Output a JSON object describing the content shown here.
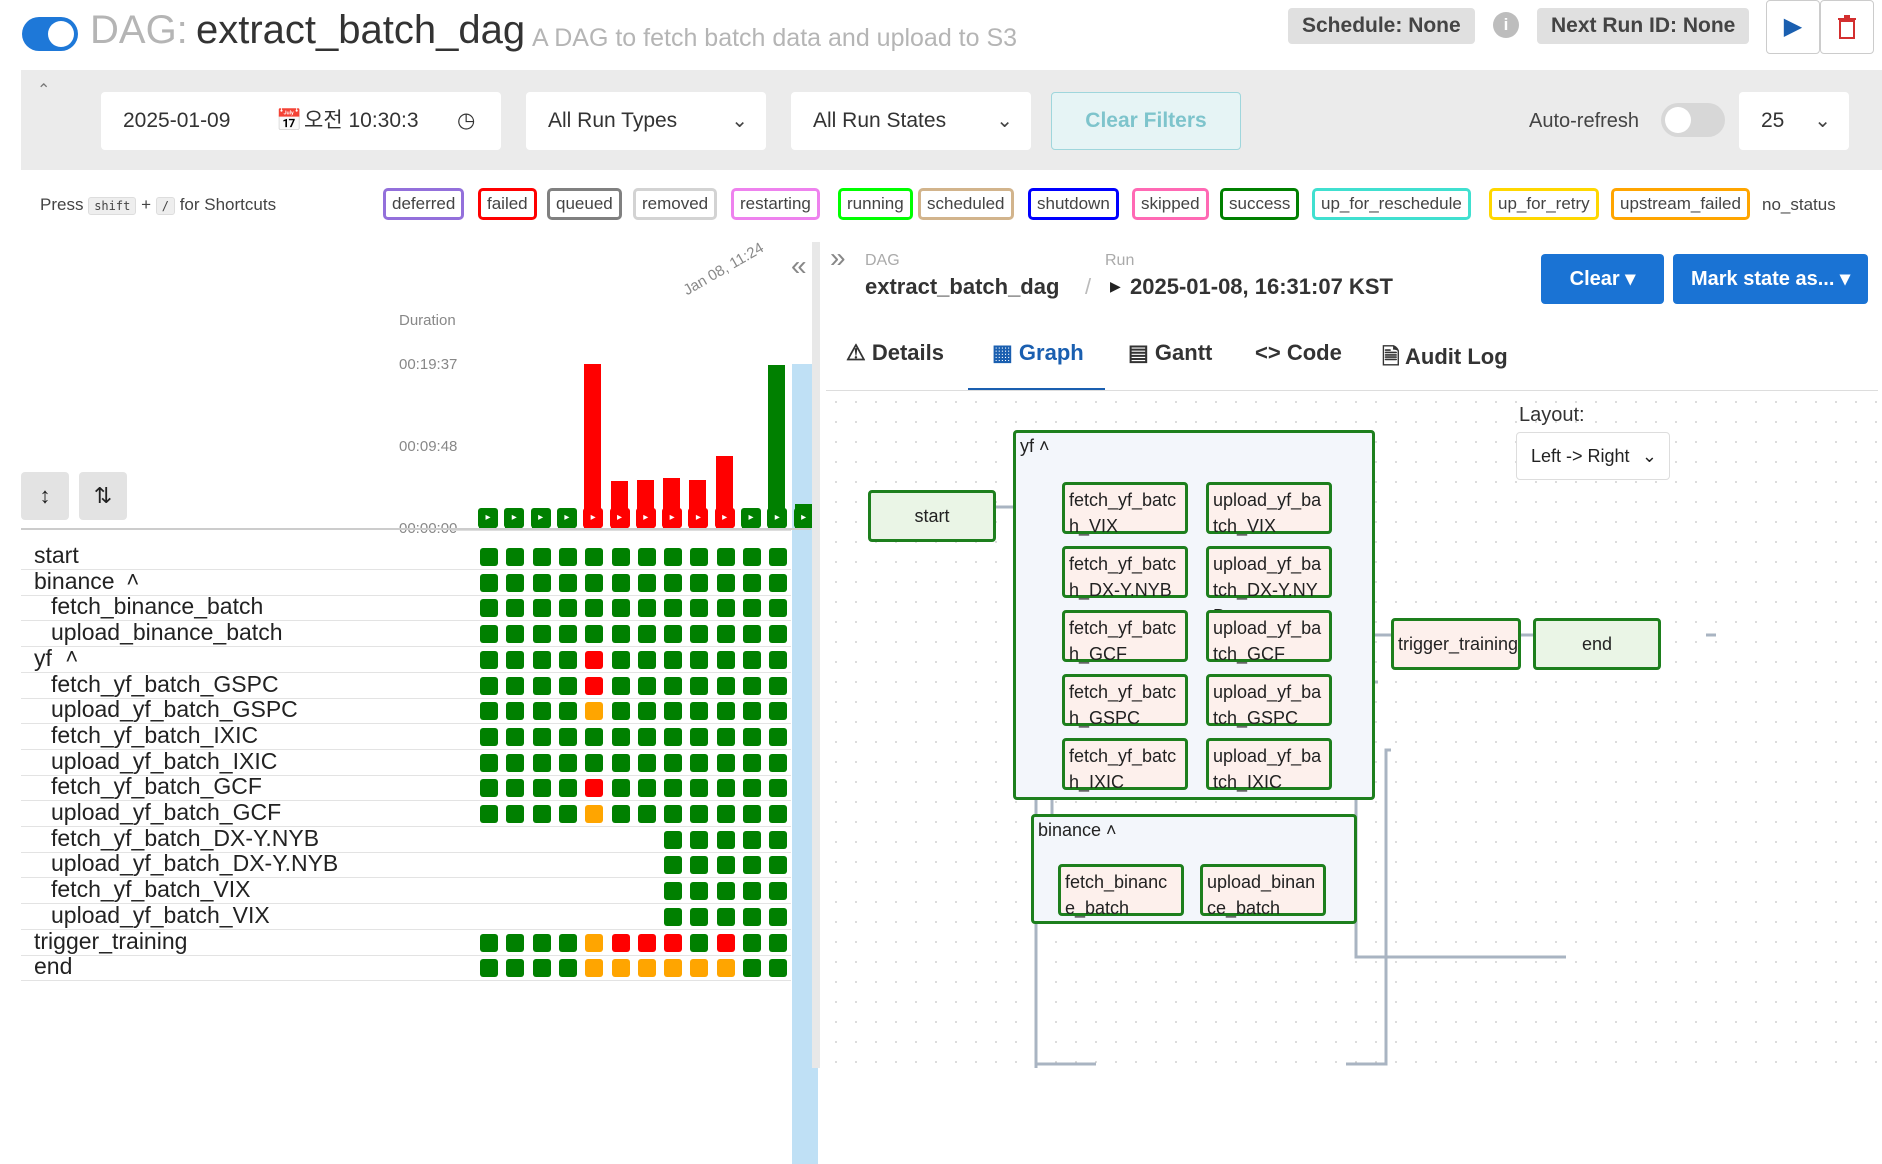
{
  "header": {
    "dag_prefix": "DAG:",
    "dag_name": "extract_batch_dag",
    "description": "A DAG to fetch batch data and upload to S3",
    "schedule": "Schedule: None",
    "next_run": "Next Run ID: None"
  },
  "filters": {
    "date": "2025-01-09",
    "time": "오전 10:30:3",
    "run_types": "All Run Types",
    "run_states": "All Run States",
    "clear_filters": "Clear Filters",
    "auto_refresh": "Auto-refresh",
    "page_size": "25"
  },
  "legend": {
    "press": "Press",
    "key1": "shift",
    "plus": "+",
    "key2": "/",
    "for_shortcuts": "for Shortcuts",
    "states": [
      {
        "label": "deferred",
        "color": "#9370DB"
      },
      {
        "label": "failed",
        "color": "#FF0000"
      },
      {
        "label": "queued",
        "color": "#808080"
      },
      {
        "label": "removed",
        "color": "#D3D3D3"
      },
      {
        "label": "restarting",
        "color": "#EE82EE"
      },
      {
        "label": "running",
        "color": "#00FF00"
      },
      {
        "label": "scheduled",
        "color": "#D2B48C"
      },
      {
        "label": "shutdown",
        "color": "#0000FF"
      },
      {
        "label": "skipped",
        "color": "#FF69B4"
      },
      {
        "label": "success",
        "color": "#008000"
      },
      {
        "label": "up_for_reschedule",
        "color": "#40E0D0"
      },
      {
        "label": "up_for_retry",
        "color": "#FFD700"
      },
      {
        "label": "upstream_failed",
        "color": "#FFA500"
      }
    ],
    "no_status": "no_status"
  },
  "grid": {
    "duration_label": "Duration",
    "ticks": [
      "00:19:37",
      "00:09:48",
      "00:00:00"
    ],
    "date_label": "Jan 08, 11:24",
    "run_durations_min": [
      0.6,
      0.6,
      0.6,
      0.6,
      19.6,
      5.6,
      5.8,
      6.0,
      5.8,
      8.6,
      0.6,
      19.5,
      2.9
    ],
    "run_states": [
      "success",
      "success",
      "success",
      "success",
      "failed",
      "failed",
      "failed",
      "failed",
      "failed",
      "failed",
      "success",
      "success",
      "success"
    ],
    "rows": [
      {
        "label": "start",
        "indent": 0,
        "cells": [
          "g",
          "g",
          "g",
          "g",
          "g",
          "g",
          "g",
          "g",
          "g",
          "g",
          "g",
          "g"
        ]
      },
      {
        "label": "binance",
        "indent": 0,
        "group": true,
        "cells": [
          "g",
          "g",
          "g",
          "g",
          "g",
          "g",
          "g",
          "g",
          "g",
          "g",
          "g",
          "g"
        ]
      },
      {
        "label": "fetch_binance_batch",
        "indent": 1,
        "cells": [
          "g",
          "g",
          "g",
          "g",
          "g",
          "g",
          "g",
          "g",
          "g",
          "g",
          "g",
          "g"
        ]
      },
      {
        "label": "upload_binance_batch",
        "indent": 1,
        "cells": [
          "g",
          "g",
          "g",
          "g",
          "g",
          "g",
          "g",
          "g",
          "g",
          "g",
          "g",
          "g"
        ]
      },
      {
        "label": "yf",
        "indent": 0,
        "group": true,
        "cells": [
          "g",
          "g",
          "g",
          "g",
          "r",
          "g",
          "g",
          "g",
          "g",
          "g",
          "g",
          "g"
        ]
      },
      {
        "label": "fetch_yf_batch_GSPC",
        "indent": 1,
        "cells": [
          "g",
          "g",
          "g",
          "g",
          "r",
          "g",
          "g",
          "g",
          "g",
          "g",
          "g",
          "g"
        ]
      },
      {
        "label": "upload_yf_batch_GSPC",
        "indent": 1,
        "cells": [
          "g",
          "g",
          "g",
          "g",
          "o",
          "g",
          "g",
          "g",
          "g",
          "g",
          "g",
          "g"
        ]
      },
      {
        "label": "fetch_yf_batch_IXIC",
        "indent": 1,
        "cells": [
          "g",
          "g",
          "g",
          "g",
          "g",
          "g",
          "g",
          "g",
          "g",
          "g",
          "g",
          "g"
        ]
      },
      {
        "label": "upload_yf_batch_IXIC",
        "indent": 1,
        "cells": [
          "g",
          "g",
          "g",
          "g",
          "g",
          "g",
          "g",
          "g",
          "g",
          "g",
          "g",
          "g"
        ]
      },
      {
        "label": "fetch_yf_batch_GCF",
        "indent": 1,
        "cells": [
          "g",
          "g",
          "g",
          "g",
          "r",
          "g",
          "g",
          "g",
          "g",
          "g",
          "g",
          "g"
        ]
      },
      {
        "label": "upload_yf_batch_GCF",
        "indent": 1,
        "cells": [
          "g",
          "g",
          "g",
          "g",
          "o",
          "g",
          "g",
          "g",
          "g",
          "g",
          "g",
          "g"
        ]
      },
      {
        "label": "fetch_yf_batch_DX-Y.NYB",
        "indent": 1,
        "cells": [
          "",
          "",
          "",
          "",
          "",
          "",
          "",
          "g",
          "g",
          "g",
          "g",
          "g"
        ]
      },
      {
        "label": "upload_yf_batch_DX-Y.NYB",
        "indent": 1,
        "cells": [
          "",
          "",
          "",
          "",
          "",
          "",
          "",
          "g",
          "g",
          "g",
          "g",
          "g"
        ]
      },
      {
        "label": "fetch_yf_batch_VIX",
        "indent": 1,
        "cells": [
          "",
          "",
          "",
          "",
          "",
          "",
          "",
          "g",
          "g",
          "g",
          "g",
          "g"
        ]
      },
      {
        "label": "upload_yf_batch_VIX",
        "indent": 1,
        "cells": [
          "",
          "",
          "",
          "",
          "",
          "",
          "",
          "g",
          "g",
          "g",
          "g",
          "g"
        ]
      },
      {
        "label": "trigger_training",
        "indent": 0,
        "cells": [
          "g",
          "g",
          "g",
          "g",
          "o",
          "r",
          "r",
          "r",
          "g",
          "r",
          "g",
          "g"
        ]
      },
      {
        "label": "end",
        "indent": 0,
        "cells": [
          "g",
          "g",
          "g",
          "g",
          "o",
          "o",
          "o",
          "o",
          "o",
          "o",
          "g",
          "g"
        ]
      }
    ]
  },
  "details": {
    "dag_caption": "DAG",
    "run_caption": "Run",
    "dag_name": "extract_batch_dag",
    "run_id": "2025-01-08, 16:31:07 KST",
    "clear_btn": "Clear",
    "mark_btn": "Mark state as...",
    "tabs": [
      "Details",
      "Graph",
      "Gantt",
      "Code",
      "Audit Log"
    ],
    "active_tab": "Graph",
    "layout_label": "Layout:",
    "layout_value": "Left -> Right"
  },
  "graph": {
    "start": "start",
    "yf_group": "yf",
    "binance_group": "binance",
    "trigger": "trigger_training",
    "end": "end",
    "yf_tasks": [
      [
        "fetch_yf_batch_VIX",
        "upload_yf_batch_VIX"
      ],
      [
        "fetch_yf_batch_DX-Y.NYB",
        "upload_yf_batch_DX-Y.NYB"
      ],
      [
        "fetch_yf_batch_GCF",
        "upload_yf_batch_GCF"
      ],
      [
        "fetch_yf_batch_GSPC",
        "upload_yf_batch_GSPC"
      ],
      [
        "fetch_yf_batch_IXIC",
        "upload_yf_batch_IXIC"
      ]
    ],
    "binance_tasks": [
      "fetch_binance_batch",
      "upload_binance_batch"
    ]
  },
  "colors": {
    "success": "#008000",
    "failed": "#FF0000",
    "upstream_failed": "#FFA500",
    "accent": "#1a73d4"
  }
}
